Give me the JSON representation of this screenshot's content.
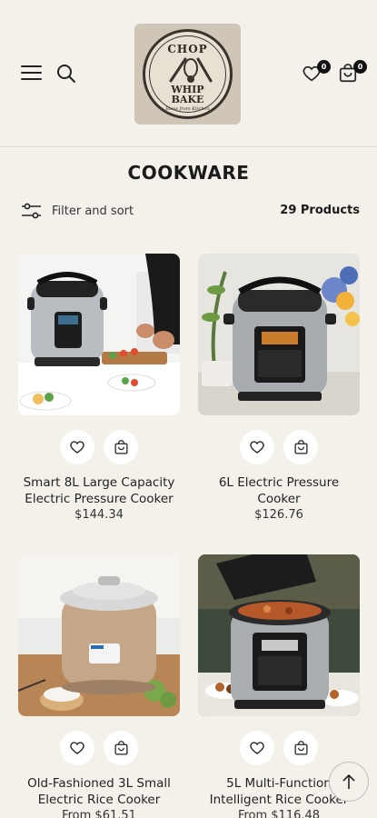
{
  "header": {
    "logo": {
      "line1": "CHOP",
      "line2": "WHIP",
      "line3": "BAKE",
      "sub": "Ideas from Kitchen"
    },
    "wishlist_count": "0",
    "cart_count": "0"
  },
  "collection": {
    "title": "COOKWARE",
    "filter_label": "Filter and sort",
    "product_count": "29 Products"
  },
  "products": [
    {
      "title_line1": "Smart 8L Large Capacity",
      "title_line2": "Electric Pressure Cooker",
      "price": "$144.34"
    },
    {
      "title_line1": "6L Electric Pressure",
      "title_line2": "Cooker",
      "price": "$126.76"
    },
    {
      "title_line1": "Old-Fashioned 3L Small",
      "title_line2": "Electric Rice Cooker",
      "price": "From $61.51"
    },
    {
      "title_line1": "5L Multi-Function",
      "title_line2": "Intelligent Rice Cooker",
      "price": "From $116.48"
    }
  ]
}
